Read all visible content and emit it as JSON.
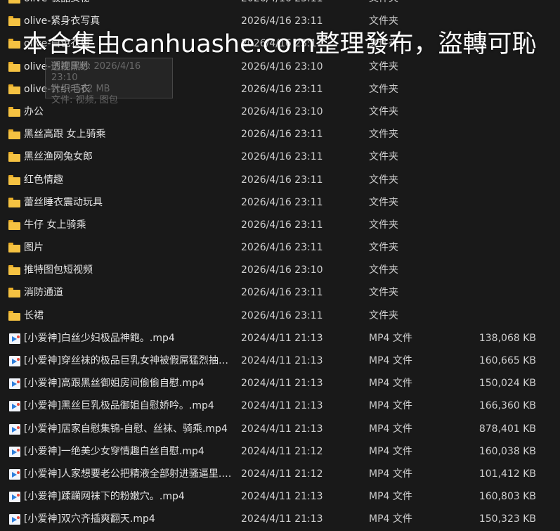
{
  "files": [
    {
      "name": "olive-极品女秘",
      "date": "2026/4/16 23:11",
      "type": "文件夹",
      "size": "",
      "kind": "folder"
    },
    {
      "name": "olive-紧身衣写真",
      "date": "2026/4/16 23:11",
      "type": "文件夹",
      "size": "",
      "kind": "folder"
    },
    {
      "name": "olive-白色衣帽",
      "date": "2026/4/16 23:11",
      "type": "文件夹",
      "size": "",
      "kind": "folder"
    },
    {
      "name": "olive-透视黑纱",
      "date": "2026/4/16 23:10",
      "type": "文件夹",
      "size": "",
      "kind": "folder"
    },
    {
      "name": "olive-针织毛衣",
      "date": "2026/4/16 23:11",
      "type": "文件夹",
      "size": "",
      "kind": "folder"
    },
    {
      "name": "办公",
      "date": "2026/4/16 23:10",
      "type": "文件夹",
      "size": "",
      "kind": "folder"
    },
    {
      "name": "黑丝高跟 女上骑乘",
      "date": "2026/4/16 23:11",
      "type": "文件夹",
      "size": "",
      "kind": "folder"
    },
    {
      "name": "黑丝渔网兔女郎",
      "date": "2026/4/16 23:11",
      "type": "文件夹",
      "size": "",
      "kind": "folder"
    },
    {
      "name": "红色情趣",
      "date": "2026/4/16 23:11",
      "type": "文件夹",
      "size": "",
      "kind": "folder"
    },
    {
      "name": "蕾丝睡衣震动玩具",
      "date": "2026/4/16 23:11",
      "type": "文件夹",
      "size": "",
      "kind": "folder"
    },
    {
      "name": "牛仔 女上骑乘",
      "date": "2026/4/16 23:11",
      "type": "文件夹",
      "size": "",
      "kind": "folder"
    },
    {
      "name": "图片",
      "date": "2026/4/16 23:11",
      "type": "文件夹",
      "size": "",
      "kind": "folder"
    },
    {
      "name": "推特图包短视频",
      "date": "2026/4/16 23:10",
      "type": "文件夹",
      "size": "",
      "kind": "folder"
    },
    {
      "name": "消防通道",
      "date": "2026/4/16 23:11",
      "type": "文件夹",
      "size": "",
      "kind": "folder"
    },
    {
      "name": "长裙",
      "date": "2026/4/16 23:11",
      "type": "文件夹",
      "size": "",
      "kind": "folder"
    },
    {
      "name": "[小爱神]白丝少妇极品神鲍。.mp4",
      "date": "2024/4/11 21:13",
      "type": "MP4 文件",
      "size": "138,068 KB",
      "kind": "mp4"
    },
    {
      "name": "[小爱神]穿丝袜的极品巨乳女神被假屌猛烈抽插...",
      "date": "2024/4/11 21:13",
      "type": "MP4 文件",
      "size": "160,665 KB",
      "kind": "mp4"
    },
    {
      "name": "[小爱神]高跟黑丝御姐房间偷偷自慰.mp4",
      "date": "2024/4/11 21:13",
      "type": "MP4 文件",
      "size": "150,024 KB",
      "kind": "mp4"
    },
    {
      "name": "[小爱神]黑丝巨乳极品御姐自慰娇吟。.mp4",
      "date": "2024/4/11 21:13",
      "type": "MP4 文件",
      "size": "166,360 KB",
      "kind": "mp4"
    },
    {
      "name": "[小爱神]居家自慰集锦-自慰、丝袜、骑乘.mp4",
      "date": "2024/4/11 21:13",
      "type": "MP4 文件",
      "size": "878,401 KB",
      "kind": "mp4"
    },
    {
      "name": "[小爱神]一绝美少女穿情趣白丝自慰.mp4",
      "date": "2024/4/11 21:12",
      "type": "MP4 文件",
      "size": "160,038 KB",
      "kind": "mp4"
    },
    {
      "name": "[小爱神]人家想要老公把精液全部射进骚逼里.m...",
      "date": "2024/4/11 21:12",
      "type": "MP4 文件",
      "size": "101,412 KB",
      "kind": "mp4"
    },
    {
      "name": "[小爱神]蹂躏网袜下的粉嫩穴。.mp4",
      "date": "2024/4/11 21:13",
      "type": "MP4 文件",
      "size": "160,803 KB",
      "kind": "mp4"
    },
    {
      "name": "[小爱神]双穴齐插爽翻天.mp4",
      "date": "2024/4/11 21:13",
      "type": "MP4 文件",
      "size": "150,323 KB",
      "kind": "mp4"
    }
  ],
  "tooltip": {
    "date_line": "创建日期: 2026/4/16 23:10",
    "size_line": "大小: 562 MB",
    "files_line": "文件: 视频, 图包"
  },
  "watermark": "本合集由canhuashe.com整理發布，盜轉可恥",
  "colors": {
    "folder": "#f5c242",
    "background": "#191919",
    "text": "#d8d8d8"
  }
}
